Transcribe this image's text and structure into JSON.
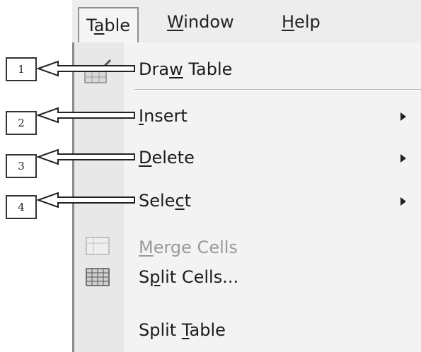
{
  "menubar": {
    "items": [
      {
        "pre": "T",
        "u": "a",
        "post": "ble"
      },
      {
        "pre": "",
        "u": "W",
        "post": "indow"
      },
      {
        "pre": "",
        "u": "H",
        "post": "elp"
      }
    ]
  },
  "menu": {
    "items": [
      {
        "pre": "Dra",
        "u": "w",
        "post": " Table"
      },
      {
        "pre": "",
        "u": "I",
        "post": "nsert"
      },
      {
        "pre": "",
        "u": "D",
        "post": "elete"
      },
      {
        "pre": "Sele",
        "u": "c",
        "post": "t"
      },
      {
        "pre": "",
        "u": "M",
        "post": "erge Cells"
      },
      {
        "pre": "S",
        "u": "p",
        "post": "lit Cells..."
      },
      {
        "pre": "Split ",
        "u": "T",
        "post": "able"
      }
    ]
  },
  "callouts": [
    "1",
    "2",
    "3",
    "4"
  ],
  "colors": {
    "disabled_text": "#9a9a9a",
    "icon_column": "#e8e8e8"
  }
}
